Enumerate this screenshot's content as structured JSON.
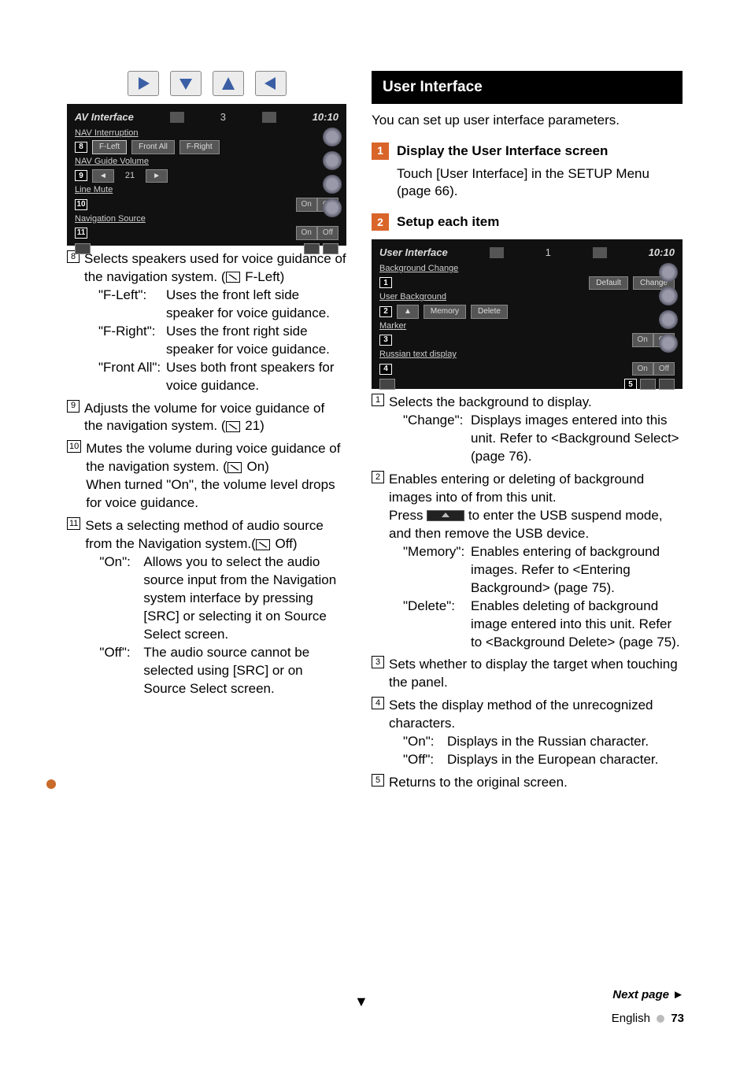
{
  "left_dev": {
    "title": "AV Interface",
    "page": "3",
    "time": "10:10",
    "row1": {
      "label": "NAV Interruption",
      "ref": "8",
      "opts": [
        "F-Left",
        "Front All",
        "F-Right"
      ]
    },
    "row2": {
      "label": "NAV Guide Volume",
      "ref": "9",
      "value": "21"
    },
    "row3": {
      "label": "Line Mute",
      "ref": "10",
      "on": "On",
      "off": "Off"
    },
    "row4": {
      "label": "Navigation Source",
      "ref": "11",
      "on": "On",
      "off": "Off"
    }
  },
  "left_items": [
    {
      "ref": "8",
      "text": "Selects speakers used for voice guidance of the navigation system. (",
      "def_suffix": " F-Left)",
      "defs": [
        {
          "t": "\"F-Left\":",
          "d": "Uses the front left side speaker for voice guidance."
        },
        {
          "t": "\"F-Right\":",
          "d": "Uses the front right side speaker for voice guidance."
        },
        {
          "t": "\"Front All\":",
          "d": "Uses both front speakers for voice guidance."
        }
      ]
    },
    {
      "ref": "9",
      "text": "Adjusts the volume for voice guidance of the navigation system. (",
      "def_suffix": " 21)"
    },
    {
      "ref": "10",
      "text": "Mutes the volume during voice guidance of the navigation system. (",
      "def_suffix": " On)",
      "extra": "When turned \"On\", the volume level drops for voice guidance."
    },
    {
      "ref": "11",
      "text": "Sets a selecting method of audio source from the Navigation system.(",
      "def_suffix": " Off)",
      "defs": [
        {
          "t": "\"On\":",
          "d": "Allows you to select the audio source input from the Navigation system interface by pressing [SRC] or selecting it on Source Select screen."
        },
        {
          "t": "\"Off\":",
          "d": "The audio source cannot be selected using [SRC] or on Source Select screen."
        }
      ]
    }
  ],
  "right": {
    "section": "User Interface",
    "intro": "You can set up user interface parameters.",
    "step1": {
      "n": "1",
      "title": "Display the User Interface screen",
      "body": "Touch [User Interface] in the SETUP Menu (page 66)."
    },
    "step2": {
      "n": "2",
      "title": "Setup each item"
    },
    "dev": {
      "title": "User Interface",
      "page": "1",
      "time": "10:10",
      "rows": [
        {
          "ref": "1",
          "label": "Background Change",
          "btns": [
            "Default",
            "Change"
          ]
        },
        {
          "ref": "2",
          "label": "User Background",
          "btns": [
            "Memory",
            "Delete"
          ]
        },
        {
          "ref": "3",
          "label": "Marker",
          "on": "On",
          "off": "Off"
        },
        {
          "ref": "4",
          "label": "Russian text display",
          "on": "On",
          "off": "Off"
        }
      ],
      "ref5": "5"
    },
    "items": [
      {
        "ref": "1",
        "text": "Selects the background to display.",
        "defs": [
          {
            "t": "\"Change\":",
            "d": "Displays images entered into this unit. Refer to <Background Select> (page 76)."
          }
        ]
      },
      {
        "ref": "2",
        "text": "Enables entering or deleting of background images into of from this unit.",
        "press_pre": "Press ",
        "press_post": " to enter the USB suspend mode, and then remove the USB device.",
        "defs": [
          {
            "t": "\"Memory\":",
            "d": "Enables entering of background images. Refer to <Entering Background> (page 75)."
          },
          {
            "t": "\"Delete\":",
            "d": "Enables deleting of background image entered into this unit. Refer to <Background Delete> (page 75)."
          }
        ]
      },
      {
        "ref": "3",
        "text": "Sets whether to display the target when touching the panel."
      },
      {
        "ref": "4",
        "text": "Sets the display method of the unrecognized characters.",
        "defs": [
          {
            "t": "\"On\":",
            "d": "Displays in the Russian character."
          },
          {
            "t": "\"Off\":",
            "d": "Displays in the European character."
          }
        ]
      },
      {
        "ref": "5",
        "text": "Returns to the original screen."
      }
    ]
  },
  "footer": {
    "next": "Next page ",
    "lang": "English",
    "page": "73"
  }
}
